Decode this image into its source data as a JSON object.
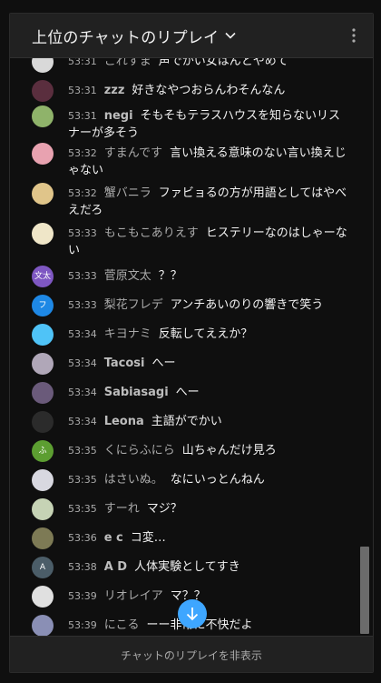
{
  "header": {
    "title": "上位のチャットのリプレイ"
  },
  "messages": [
    {
      "time": "53:31",
      "author": "これすま",
      "text": "声でかい女はんとやめて",
      "avatar": "#d9d9d9",
      "bold": false
    },
    {
      "time": "53:31",
      "author": "zzz",
      "text": "好きなやつおらんわそんなん",
      "avatar": "#5a2e3e",
      "bold": true
    },
    {
      "time": "53:31",
      "author": "negi",
      "text": "そもそもテラスハウスを知らないリスナーが多そう",
      "avatar": "#8fb36a",
      "bold": true
    },
    {
      "time": "53:32",
      "author": "すまんです",
      "text": "言い換える意味のない言い換えじゃない",
      "avatar": "#e8a2b0",
      "bold": false
    },
    {
      "time": "53:32",
      "author": "蟹バニラ",
      "text": "ファビョるの方が用語としてはやべえだろ",
      "avatar": "#e0c58a",
      "bold": false
    },
    {
      "time": "53:33",
      "author": "もこもこありえす",
      "text": "ヒステリーなのはしゃーない",
      "avatar": "#efe6c8",
      "bold": false
    },
    {
      "time": "53:33",
      "author": "菅原文太",
      "text": "？？",
      "avatar": "#7e57c2",
      "initial": "文太",
      "bold": false
    },
    {
      "time": "53:33",
      "author": "梨花フレデ",
      "text": "アンチあいのりの響きで笑う",
      "avatar": "#1e88e5",
      "initial": "フ",
      "bold": false
    },
    {
      "time": "53:34",
      "author": "キヨナミ",
      "text": "反転してええか？",
      "avatar": "#4fc3f7",
      "bold": false
    },
    {
      "time": "53:34",
      "author": "Tacosi",
      "text": "へー",
      "avatar": "#b0a7b8",
      "bold": true
    },
    {
      "time": "53:34",
      "author": "Sabiasagi",
      "text": "へー",
      "avatar": "#6a5a7a",
      "bold": true
    },
    {
      "time": "53:34",
      "author": "Leona",
      "text": "主語がでかい",
      "avatar": "#2b2b2b",
      "bold": true
    },
    {
      "time": "53:35",
      "author": "くにらふにら",
      "text": "山ちゃんだけ見ろ",
      "avatar": "#5c9e31",
      "initial": "ふ",
      "bold": false
    },
    {
      "time": "53:35",
      "author": "はさいぬ。",
      "text": "なにいっとんねん",
      "avatar": "#d8d8e0",
      "bold": false
    },
    {
      "time": "53:35",
      "author": "すーれ",
      "text": "マジ？",
      "avatar": "#c6d3b5",
      "bold": false
    },
    {
      "time": "53:36",
      "author": "e c",
      "text": "コ変…",
      "avatar": "#7d7a55",
      "bold": true
    },
    {
      "time": "53:38",
      "author": "A D",
      "text": "人体実験としてすき",
      "avatar": "#4b5d68",
      "initial": "A",
      "bold": true
    },
    {
      "time": "53:39",
      "author": "リオレイア",
      "text": "マ？？",
      "avatar": "#e0e0e0",
      "bold": false
    },
    {
      "time": "53:39",
      "author": "にこる",
      "text": "ーー非常に不快だよ",
      "avatar": "#8a8fb5",
      "bold": false
    }
  ],
  "footer": {
    "hide_label": "チャットのリプレイを非表示"
  }
}
